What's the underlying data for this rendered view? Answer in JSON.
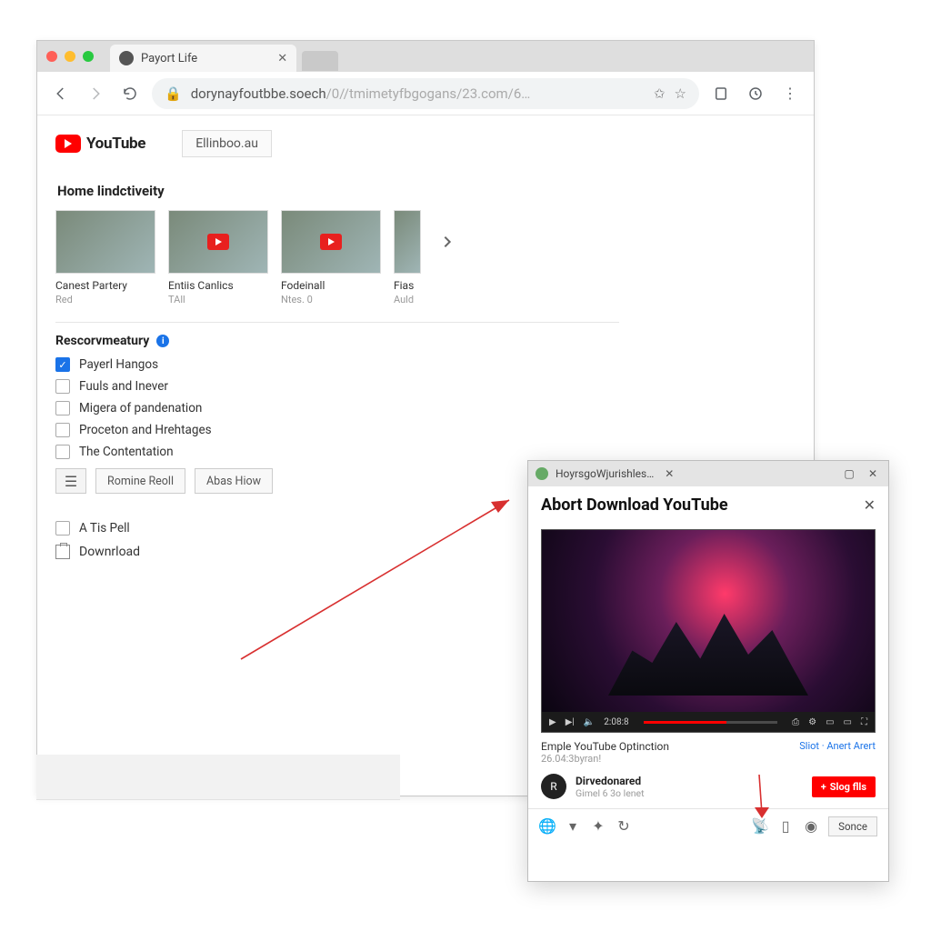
{
  "browser": {
    "tab_title": "Payort Life",
    "url_domain": "dorynayfoutbbe.soech",
    "url_path": "/0//tmimetyfbgogans/23.com/6…"
  },
  "youtube": {
    "brand": "YouTube",
    "search_label": "Ellinboo.au"
  },
  "section1_title": "Home lindctiveity",
  "thumbs": [
    {
      "title": "Canest Partery",
      "sub": "Red"
    },
    {
      "title": "Entiis Canlics",
      "sub": "TAll"
    },
    {
      "title": "Fodeinall",
      "sub": "Ntes. 0"
    },
    {
      "title": "Fias",
      "sub": "Auld"
    }
  ],
  "category": {
    "title": "Rescorvmeatury",
    "items": [
      {
        "label": "Payerl Hangos",
        "checked": true
      },
      {
        "label": "Fuuls and Inever",
        "checked": false
      },
      {
        "label": "Migera of pandenation",
        "checked": false
      },
      {
        "label": "Proceton and Hrehtages",
        "checked": false
      },
      {
        "label": "The Contentation",
        "checked": false
      }
    ],
    "btn1": "Romine Reoll",
    "btn2": "Abas Hiow",
    "extra_item": "A Tis Pell",
    "download_label": "Downrload"
  },
  "popup": {
    "titlebar": "HoyrsgoWjurishles…",
    "heading": "Abort Download YouTube",
    "controls_time": "2:08:8",
    "video_title": "Emple YouTube Optinction",
    "video_sub": "26.04:3byran!",
    "actions": "Sliot · Anert Arert",
    "channel_name": "Dirvedonared",
    "channel_sub": "Gimel 6 3o lenet",
    "subscribe_label": "Slog flls",
    "footer_btn": "Sonce"
  }
}
